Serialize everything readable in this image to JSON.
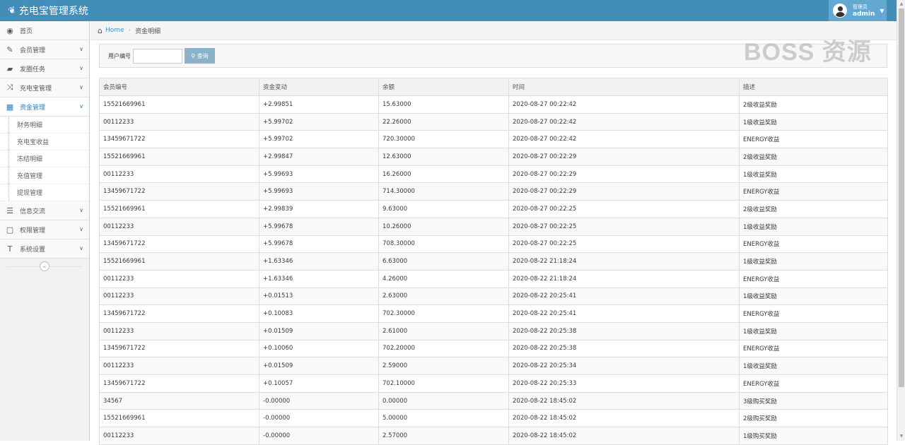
{
  "app": {
    "title": "充电宝管理系统",
    "logo_icon": "leaf-icon"
  },
  "user": {
    "role": "管理员",
    "name": "admin"
  },
  "sidebar": {
    "items": [
      {
        "label": "首页",
        "icon": "dashboard-icon"
      },
      {
        "label": "会员管理",
        "icon": "edit-icon"
      },
      {
        "label": "发圈任务",
        "icon": "book-icon"
      },
      {
        "label": "充电宝管理",
        "icon": "shuffle-icon"
      },
      {
        "label": "资金管理",
        "icon": "calendar-icon"
      },
      {
        "label": "信息交流",
        "icon": "list-alt-icon"
      },
      {
        "label": "权限管理",
        "icon": "file-icon"
      },
      {
        "label": "系统设置",
        "icon": "text-icon"
      }
    ],
    "sub_items": [
      "财务明细",
      "充电宝收益",
      "冻结明细",
      "充值管理",
      "提现管理"
    ]
  },
  "breadcrumb": {
    "home": "Home",
    "current": "资金明细"
  },
  "search": {
    "label": "用户编号",
    "value": "",
    "button": "查询"
  },
  "watermark": "BOSS 资源",
  "table": {
    "headers": [
      "会员编号",
      "资金变动",
      "余额",
      "时间",
      "描述"
    ],
    "rows": [
      [
        "15521669961",
        "+2.99851",
        "15.63000",
        "2020-08-27 00:22:42",
        "2级收益奖励"
      ],
      [
        "00112233",
        "+5.99702",
        "22.26000",
        "2020-08-27 00:22:42",
        "1级收益奖励"
      ],
      [
        "13459671722",
        "+5.99702",
        "720.30000",
        "2020-08-27 00:22:42",
        "ENERGY收益"
      ],
      [
        "15521669961",
        "+2.99847",
        "12.63000",
        "2020-08-27 00:22:29",
        "2级收益奖励"
      ],
      [
        "00112233",
        "+5.99693",
        "16.26000",
        "2020-08-27 00:22:29",
        "1级收益奖励"
      ],
      [
        "13459671722",
        "+5.99693",
        "714.30000",
        "2020-08-27 00:22:29",
        "ENERGY收益"
      ],
      [
        "15521669961",
        "+2.99839",
        "9.63000",
        "2020-08-27 00:22:25",
        "2级收益奖励"
      ],
      [
        "00112233",
        "+5.99678",
        "10.26000",
        "2020-08-27 00:22:25",
        "1级收益奖励"
      ],
      [
        "13459671722",
        "+5.99678",
        "708.30000",
        "2020-08-27 00:22:25",
        "ENERGY收益"
      ],
      [
        "15521669961",
        "+1.63346",
        "6.63000",
        "2020-08-22 21:18:24",
        "1级收益奖励"
      ],
      [
        "00112233",
        "+1.63346",
        "4.26000",
        "2020-08-22 21:18:24",
        "ENERGY收益"
      ],
      [
        "00112233",
        "+0.01513",
        "2.63000",
        "2020-08-22 20:25:41",
        "1级收益奖励"
      ],
      [
        "13459671722",
        "+0.10083",
        "702.30000",
        "2020-08-22 20:25:41",
        "ENERGY收益"
      ],
      [
        "00112233",
        "+0.01509",
        "2.61000",
        "2020-08-22 20:25:38",
        "1级收益奖励"
      ],
      [
        "13459671722",
        "+0.10060",
        "702.20000",
        "2020-08-22 20:25:38",
        "ENERGY收益"
      ],
      [
        "00112233",
        "+0.01509",
        "2.59000",
        "2020-08-22 20:25:34",
        "1级收益奖励"
      ],
      [
        "13459671722",
        "+0.10057",
        "702.10000",
        "2020-08-22 20:25:33",
        "ENERGY收益"
      ],
      [
        "34567",
        "-0.00000",
        "0.00000",
        "2020-08-22 18:45:02",
        "3级购买奖励"
      ],
      [
        "15521669961",
        "-0.00000",
        "5.00000",
        "2020-08-22 18:45:02",
        "2级购买奖励"
      ],
      [
        "00112233",
        "-0.00000",
        "2.57000",
        "2020-08-22 18:45:02",
        "1级购买奖励"
      ]
    ]
  },
  "colors": {
    "header": "#438eb9",
    "accent": "#2b7dbc",
    "button": "#8ab2c9"
  }
}
